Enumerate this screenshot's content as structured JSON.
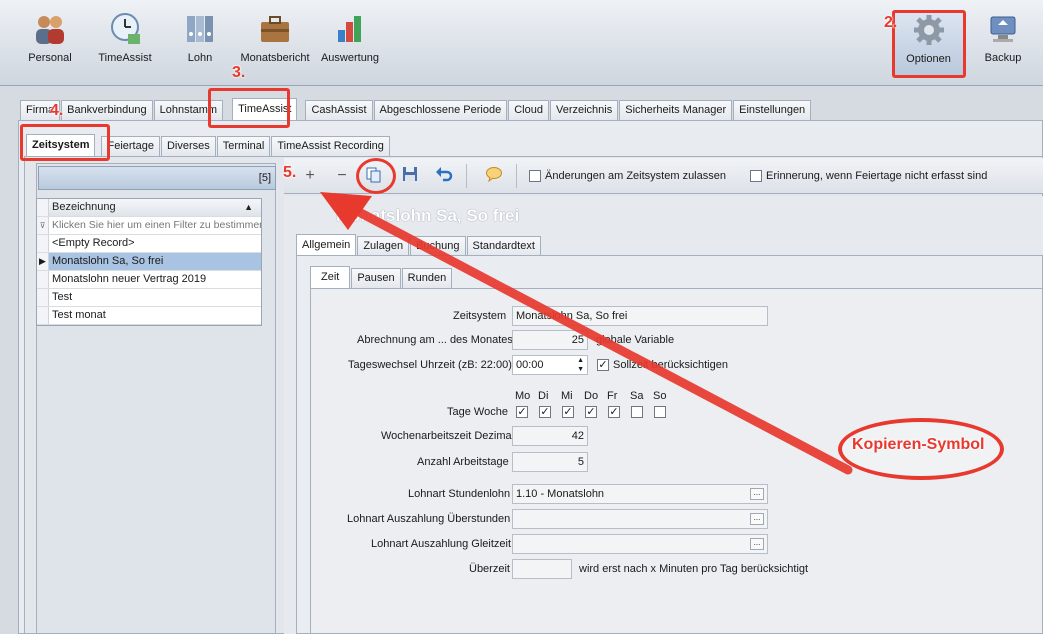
{
  "ribbon": {
    "buttons": [
      {
        "label": "Personal",
        "icon": "people-icon"
      },
      {
        "label": "TimeAssist",
        "icon": "clock-icon"
      },
      {
        "label": "Lohn",
        "icon": "binders-icon"
      },
      {
        "label": "Monatsbericht",
        "icon": "briefcase-icon"
      },
      {
        "label": "Auswertung",
        "icon": "chart-blocks-icon"
      },
      {
        "label": "Optionen",
        "icon": "gear-icon"
      },
      {
        "label": "Backup",
        "icon": "backup-computer-icon"
      }
    ]
  },
  "main_tabs": [
    "Firma",
    "Bankverbindung",
    "Lohnstamm",
    "TimeAssist",
    "CashAssist",
    "Abgeschlossene Periode",
    "Cloud",
    "Verzeichnis",
    "Sicherheits Manager",
    "Einstellungen"
  ],
  "sub_tabs": [
    "Zeitsystem",
    "Feiertage",
    "Diverses",
    "Terminal",
    "TimeAssist Recording"
  ],
  "list": {
    "count": "[5]",
    "column": "Bezeichnung",
    "filter_placeholder": "Klicken Sie hier um einen Filter zu bestimmen",
    "rows": [
      "<Empty Record>",
      "Monatslohn Sa, So frei",
      "Monatslohn neuer Vertrag 2019",
      "Test",
      "Test monat"
    ]
  },
  "toolbar": {
    "chk_allow": "Änderungen am Zeitsystem zulassen",
    "chk_reminder": "Erinnerung, wenn Feiertage nicht erfasst sind"
  },
  "record_title": "Monatslohn Sa, So frei",
  "detail_tabs": [
    "Allgemein",
    "Zulagen",
    "Buchung",
    "Standardtext"
  ],
  "inner_tabs": [
    "Zeit",
    "Pausen",
    "Runden"
  ],
  "form": {
    "zeitsystem_label": "Zeitsystem",
    "zeitsystem_value": "Monatslohn Sa, So frei",
    "abrechnung_label": "Abrechnung am ... des Monates",
    "abrechnung_value": "25",
    "globale": "globale Variable",
    "tageswechsel_label": "Tageswechsel Uhrzeit (zB: 22:00)",
    "tageswechsel_value": "00:00",
    "sollzeit": "Sollzeit berücksichtigen",
    "days": [
      "Mo",
      "Di",
      "Mi",
      "Do",
      "Fr",
      "Sa",
      "So"
    ],
    "days_checked": [
      true,
      true,
      true,
      true,
      true,
      false,
      false
    ],
    "tage_woche_label": "Tage Woche",
    "wochenarbeitszeit_label": "Wochenarbeitszeit Dezimal",
    "wochenarbeitszeit_value": "42",
    "arbeitstage_label": "Anzahl Arbeitstage",
    "arbeitstage_value": "5",
    "stundenlohn_label": "Lohnart Stundenlohn",
    "stundenlohn_value": "1.10 - Monatslohn",
    "ueberstunden_label": "Lohnart Auszahlung Überstunden",
    "gleitzeit_label": "Lohnart Auszahlung Gleitzeit",
    "ueberzeit_label": "Überzeit",
    "ueberzeit_note": "wird erst nach x Minuten pro Tag berücksichtigt"
  },
  "annotations": {
    "n2": "2.",
    "n3": "3.",
    "n4": "4.",
    "n5": "5.",
    "kopieren": "Kopieren-Symbol"
  }
}
